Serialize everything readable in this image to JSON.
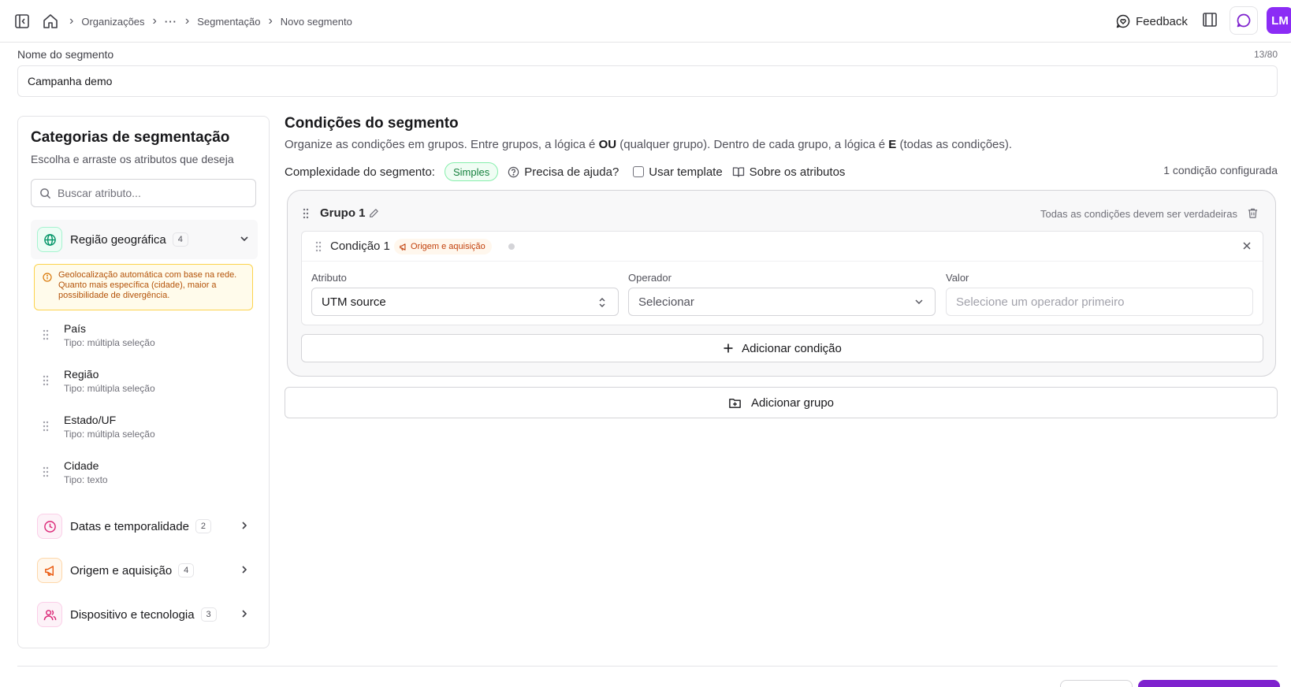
{
  "breadcrumb": {
    "items": [
      "Organizações",
      "...",
      "Segmentação",
      "Novo segmento"
    ]
  },
  "header": {
    "feedback_label": "Feedback",
    "avatar_initials": "LM",
    "avatar_color": "#8b2cf5"
  },
  "segment_name": {
    "label": "Nome do segmento",
    "value": "Campanha demo",
    "char_count": "13/80"
  },
  "categories_panel": {
    "title": "Categorias de segmentação",
    "subtitle": "Escolha e arraste os atributos que deseja",
    "search_placeholder": "Buscar atributo...",
    "categories": [
      {
        "label": "Região geográfica",
        "count": "4",
        "icon": "globe-icon",
        "expanded": true
      },
      {
        "label": "Datas e temporalidade",
        "count": "2",
        "icon": "clock-icon",
        "expanded": false
      },
      {
        "label": "Origem e aquisição",
        "count": "4",
        "icon": "megaphone-icon",
        "expanded": false
      },
      {
        "label": "Dispositivo e tecnologia",
        "count": "3",
        "icon": "users-icon",
        "expanded": false
      }
    ],
    "geo_note": "Geolocalização automática com base na rede. Quanto mais específica (cidade), maior a possibilidade de divergência.",
    "attributes": [
      {
        "name": "País",
        "type": "Tipo: múltipla seleção"
      },
      {
        "name": "Região",
        "type": "Tipo: múltipla seleção"
      },
      {
        "name": "Estado/UF",
        "type": "Tipo: múltipla seleção"
      },
      {
        "name": "Cidade",
        "type": "Tipo: texto"
      }
    ]
  },
  "conditions": {
    "title": "Condições do segmento",
    "desc_1": "Organize as condições em grupos. Entre grupos, a lógica é ",
    "desc_or": "OU",
    "desc_2": " (qualquer grupo). Dentro de cada grupo, a lógica é ",
    "desc_and": "E",
    "desc_3": " (todas as condições).",
    "complexity_label": "Complexidade do segmento:",
    "complexity_value": "Simples",
    "help_label": "Precisa de ajuda?",
    "template_label": "Usar template",
    "about_label": "Sobre os atributos",
    "count_label": "1 condição configurada",
    "group": {
      "title": "Grupo 1",
      "note": "Todas as condições devem ser verdadeiras",
      "condition": {
        "title": "Condição 1",
        "tag": "Origem e aquisição",
        "attribute_label": "Atributo",
        "attribute_value": "UTM source",
        "operator_label": "Operador",
        "operator_value": "Selecionar",
        "value_label": "Valor",
        "value_placeholder": "Selecione um operador primeiro"
      },
      "add_condition_label": "Adicionar condição"
    },
    "add_group_label": "Adicionar grupo"
  },
  "colors": {
    "accent": "#7e22ce",
    "success": "#15803d",
    "warning": "#b45309"
  }
}
